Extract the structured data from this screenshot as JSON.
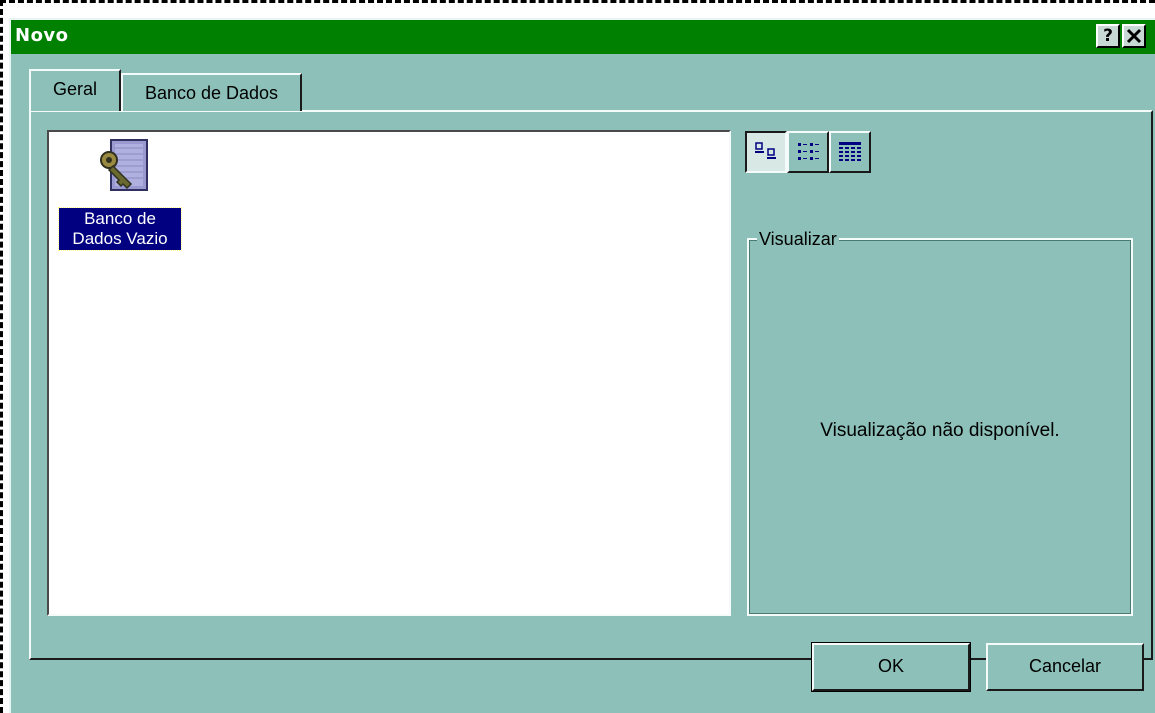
{
  "window": {
    "title": "Novo",
    "help_glyph": "?",
    "close_glyph": "✕"
  },
  "tabs": [
    {
      "label": "Geral",
      "active": true
    },
    {
      "label": "Banco de Dados",
      "active": false
    }
  ],
  "list": {
    "items": [
      {
        "label": "Banco de\nDados Vazio",
        "icon": "blank-database-icon",
        "selected": true
      }
    ]
  },
  "view_buttons": [
    {
      "icon": "large-icons-view-icon",
      "active": true
    },
    {
      "icon": "list-view-icon",
      "active": false
    },
    {
      "icon": "details-view-icon",
      "active": false
    }
  ],
  "preview": {
    "group_label": "Visualizar",
    "message": "Visualização não disponível."
  },
  "buttons": {
    "ok_label": "OK",
    "cancel_label": "Cancelar"
  },
  "colors": {
    "titlebar": "#008000",
    "face": "#8cc0b8",
    "selection": "#000080"
  }
}
